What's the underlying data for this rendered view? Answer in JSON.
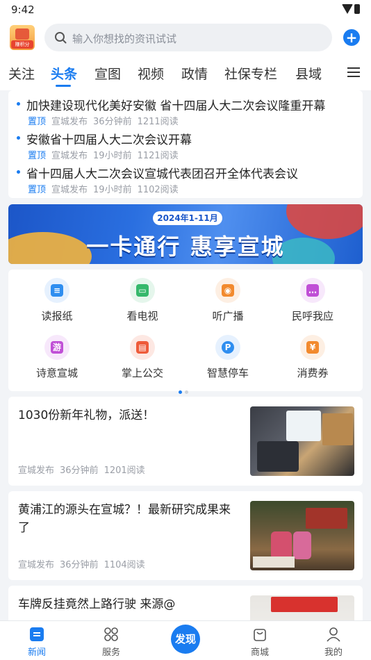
{
  "status_bar": {
    "time": "9:42"
  },
  "header": {
    "logo_badge": "赚积分",
    "search_placeholder": "输入你想找的资讯试试"
  },
  "tabs": [
    "关注",
    "头条",
    "宣图",
    "视频",
    "政情",
    "社保专栏",
    "县域"
  ],
  "active_tab": "头条",
  "hot_news": [
    {
      "title": "加快建设现代化美好安徽  省十四届人大二次会议隆重开幕",
      "pin": "置顶",
      "source": "宣城发布",
      "time": "36分钟前",
      "reads": "1211阅读"
    },
    {
      "title": "安徽省十四届人大二次会议开幕",
      "pin": "置顶",
      "source": "宣城发布",
      "time": "19小时前",
      "reads": "1121阅读"
    },
    {
      "title": "省十四届人大二次会议宣城代表团召开全体代表会议",
      "pin": "置顶",
      "source": "宣城发布",
      "time": "19小时前",
      "reads": "1102阅读"
    }
  ],
  "banner": {
    "pill": "2024年1-11月",
    "slogan": "一卡通行  惠享宣城"
  },
  "services": [
    {
      "label": "读报纸",
      "icon": "newspaper-icon",
      "color": "#2f8ef0",
      "bg": "#e6f1fe"
    },
    {
      "label": "看电视",
      "icon": "tv-icon",
      "color": "#35b86b",
      "bg": "#e5f6ec"
    },
    {
      "label": "听广播",
      "icon": "radio-icon",
      "color": "#f28a2e",
      "bg": "#fdefe3"
    },
    {
      "label": "民呼我应",
      "icon": "chat-icon",
      "color": "#c04fd6",
      "bg": "#f7e8fb"
    },
    {
      "label": "诗意宣城",
      "icon": "poetry-icon",
      "color": "#c04fd6",
      "bg": "#f7e8fb"
    },
    {
      "label": "掌上公交",
      "icon": "bus-icon",
      "color": "#ee5b3a",
      "bg": "#fde8e3"
    },
    {
      "label": "智慧停车",
      "icon": "parking-icon",
      "color": "#2f8ef0",
      "bg": "#e6f1fe"
    },
    {
      "label": "消费券",
      "icon": "coupon-icon",
      "color": "#f28a2e",
      "bg": "#fdefe3"
    }
  ],
  "poetry_glyph": "游",
  "articles": [
    {
      "title": "1030份新年礼物，派送！",
      "source": "宣城发布",
      "time": "36分钟前",
      "reads": "1201阅读"
    },
    {
      "title": "黄浦江的源头在宣城？！最新研究成果来了",
      "source": "宣城发布",
      "time": "36分钟前",
      "reads": "1104阅读"
    },
    {
      "title": "车牌反挂竟然上路行驶  来源@",
      "source": "",
      "time": "",
      "reads": ""
    }
  ],
  "bottom_nav": {
    "news": "新闻",
    "services": "服务",
    "discover": "发现",
    "mall": "商城",
    "mine": "我的"
  }
}
